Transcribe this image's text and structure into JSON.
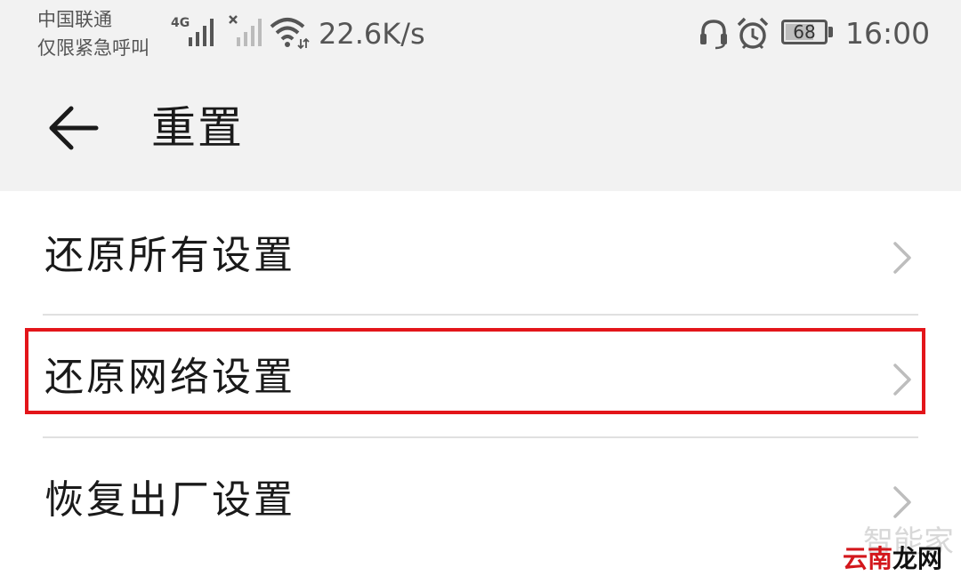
{
  "status_bar": {
    "carrier_line1": "中国联通",
    "carrier_line2": "仅限紧急呼叫",
    "network_type": "4G",
    "speed": "22.6K/s",
    "battery_percent": "68",
    "time": "16:00",
    "icons": [
      "signal-4g-icon",
      "signal-no-sim-icon",
      "wifi-icon",
      "headset-icon",
      "alarm-icon",
      "battery-icon"
    ]
  },
  "header": {
    "title": "重置",
    "back_icon": "back-arrow-icon"
  },
  "list": {
    "items": [
      {
        "label": "还原所有设置"
      },
      {
        "label": "还原网络设置",
        "highlighted": true
      },
      {
        "label": "恢复出厂设置"
      }
    ]
  },
  "watermark": {
    "top": "智能家",
    "part1": "云南",
    "part2": "龙网"
  },
  "colors": {
    "header_bg": "#f2f2f2",
    "highlight": "#e3151a",
    "chevron": "#bdbdbd"
  }
}
